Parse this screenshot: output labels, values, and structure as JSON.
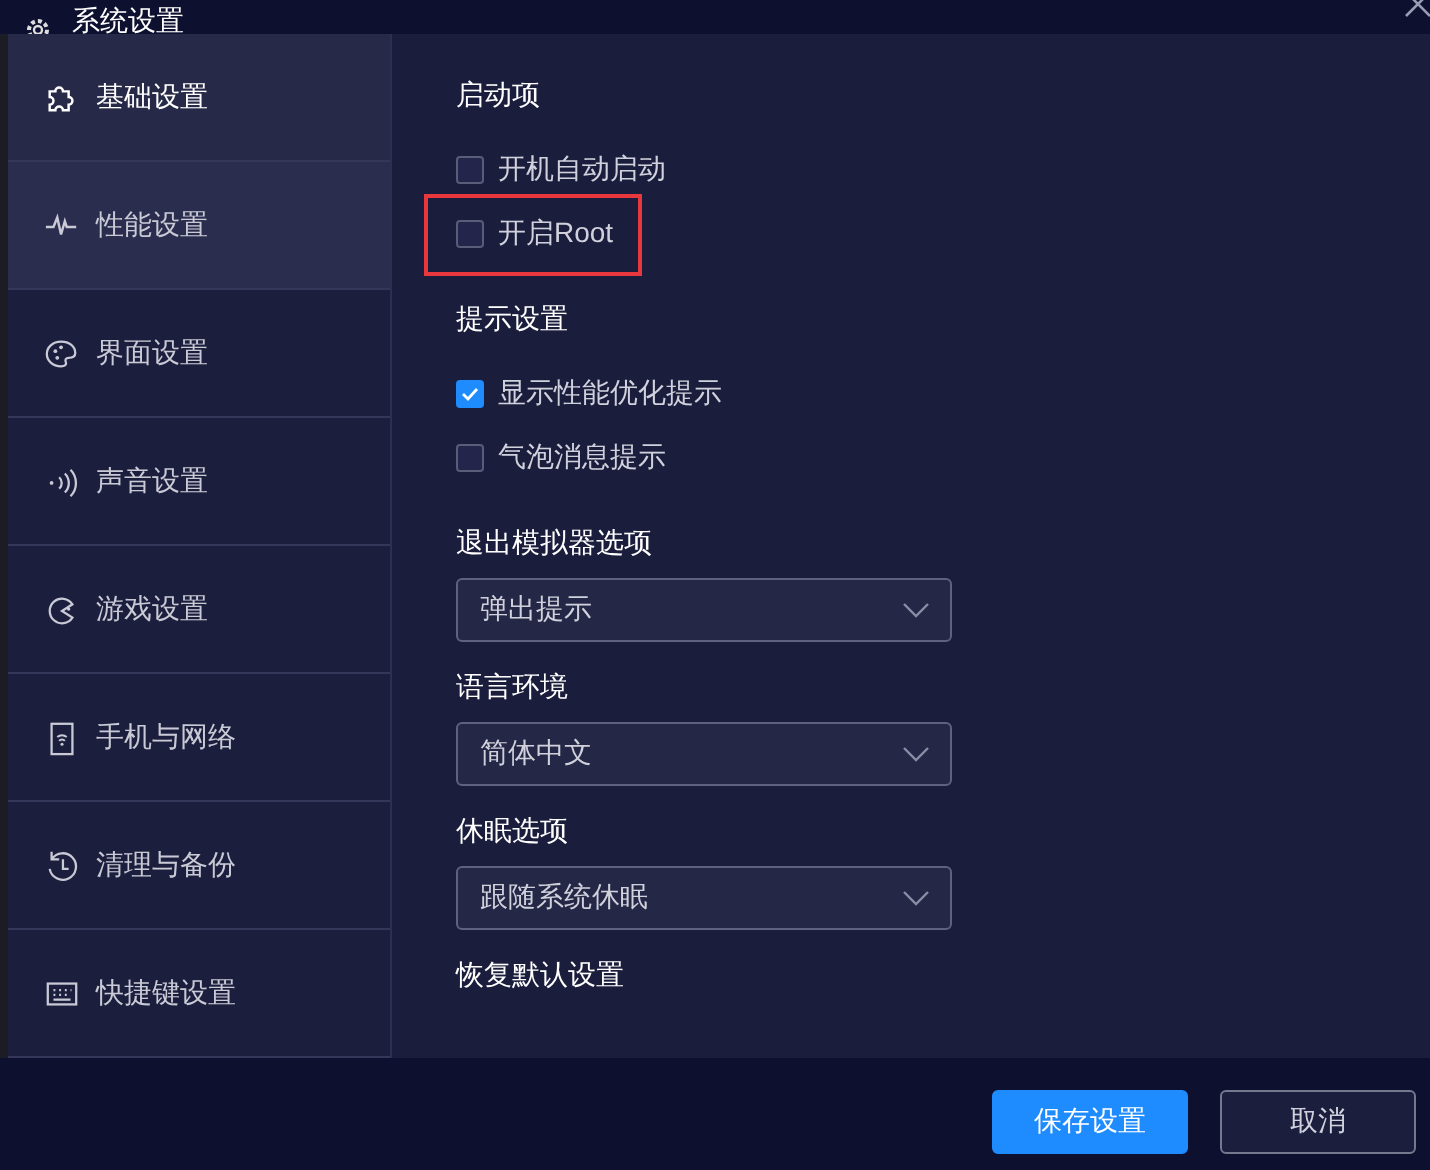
{
  "window": {
    "title": "系统设置"
  },
  "sidebar": {
    "items": [
      {
        "label": "基础设置",
        "selected": true,
        "hovered": false
      },
      {
        "label": "性能设置",
        "selected": false,
        "hovered": true
      },
      {
        "label": "界面设置",
        "selected": false,
        "hovered": false
      },
      {
        "label": "声音设置",
        "selected": false,
        "hovered": false
      },
      {
        "label": "游戏设置",
        "selected": false,
        "hovered": false
      },
      {
        "label": "手机与网络",
        "selected": false,
        "hovered": false
      },
      {
        "label": "清理与备份",
        "selected": false,
        "hovered": false
      },
      {
        "label": "快捷键设置",
        "selected": false,
        "hovered": false
      }
    ]
  },
  "sections": [
    {
      "title": "启动项",
      "kind": "checkboxes",
      "options": [
        {
          "label": "开机自动启动",
          "checked": false,
          "highlighted": false
        },
        {
          "label": "开启Root",
          "checked": false,
          "highlighted": true
        }
      ]
    },
    {
      "title": "提示设置",
      "kind": "checkboxes",
      "options": [
        {
          "label": "显示性能优化提示",
          "checked": true,
          "highlighted": false
        },
        {
          "label": "气泡消息提示",
          "checked": false,
          "highlighted": false
        }
      ]
    },
    {
      "title": "退出模拟器选项",
      "kind": "dropdown",
      "value": "弹出提示"
    },
    {
      "title": "语言环境",
      "kind": "dropdown",
      "value": "简体中文"
    },
    {
      "title": "休眠选项",
      "kind": "dropdown",
      "value": "跟随系统休眠"
    },
    {
      "title": "恢复默认设置",
      "kind": "heading"
    }
  ],
  "buttons": [
    {
      "label": "保存设置",
      "primary": true
    },
    {
      "label": "取消",
      "primary": false
    }
  ]
}
